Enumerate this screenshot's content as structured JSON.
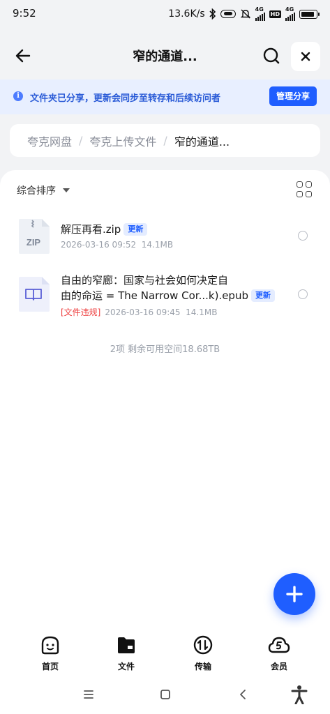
{
  "status_bar": {
    "time": "9:52",
    "net_speed": "13.6K/s",
    "net_type_1": "4G",
    "net_type_2": "4G",
    "hd_label": "HD"
  },
  "nav": {
    "title": "窄的通道..."
  },
  "share_banner": {
    "text": "文件夹已分享，更新会同步至转存和后续访问者",
    "manage_label": "管理分享"
  },
  "breadcrumb": {
    "items": [
      "夸克网盘",
      "夸克上传文件",
      "窄的通道..."
    ],
    "separator": "/"
  },
  "list": {
    "sort_label": "综合排序",
    "files": [
      {
        "name": "解压再看.zip",
        "badge": "更新",
        "icon_label": "ZIP",
        "date": "2026-03-16 09:52",
        "size": "14.1MB"
      },
      {
        "name_line1": "自由的窄廊：国家与社会如何决定自",
        "name_line2": "由的命运 = The Narrow Cor...k).epub",
        "badge": "更新",
        "violation": "[文件违规]",
        "date": "2026-03-16 09:45",
        "size": "14.1MB"
      }
    ],
    "summary": "2项 剩余可用空间18.68TB"
  },
  "tabs": [
    {
      "label": "首页",
      "icon": "home-face-icon"
    },
    {
      "label": "文件",
      "icon": "folder-icon"
    },
    {
      "label": "传输",
      "icon": "transfer-icon"
    },
    {
      "label": "会员",
      "icon": "member-cloud-icon"
    }
  ],
  "colors": {
    "accent": "#1f5eff",
    "banner_bg": "#e8efff",
    "violation": "#ee3f3f"
  }
}
